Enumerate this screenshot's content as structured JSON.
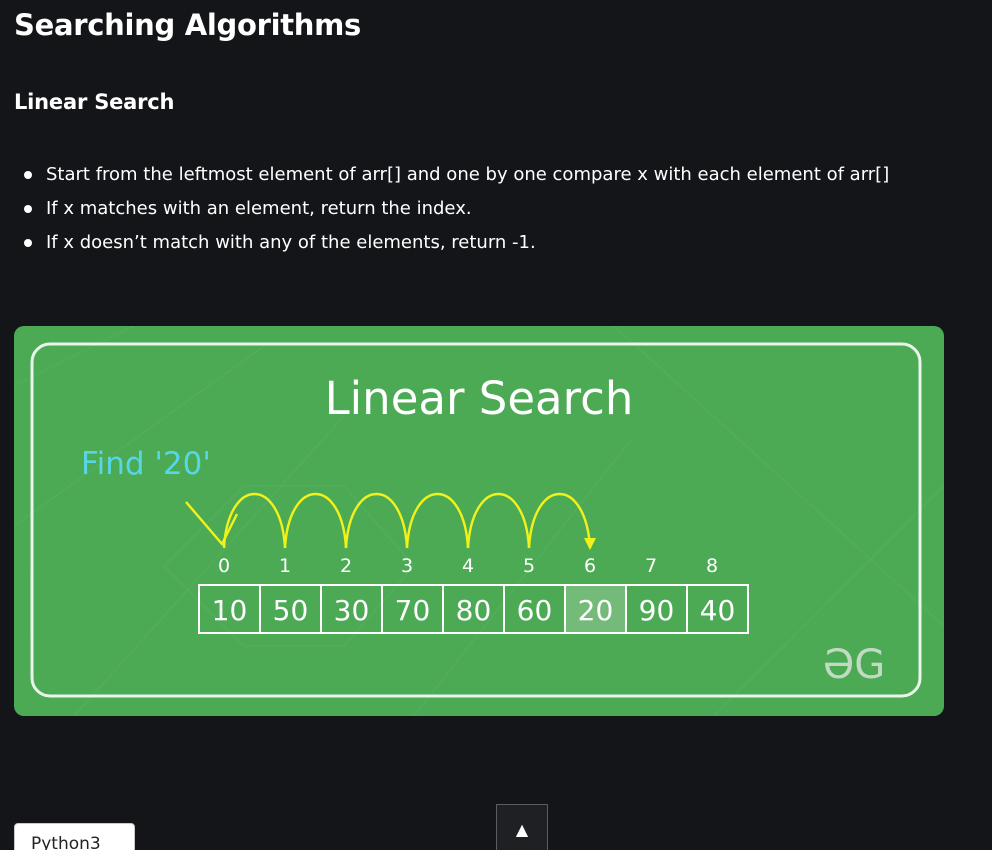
{
  "article": {
    "title": "Searching Algorithms",
    "section_title": "Linear Search",
    "bullets": [
      "Start from the leftmost element of arr[] and one by one compare x with each element of arr[]",
      "If x matches with an element, return the index.",
      "If x doesn’t match with any of the elements, return -1."
    ]
  },
  "figure": {
    "title": "Linear Search",
    "find_label": "Find '20'",
    "indices": [
      "0",
      "1",
      "2",
      "3",
      "4",
      "5",
      "6",
      "7",
      "8"
    ],
    "values": [
      "10",
      "50",
      "30",
      "70",
      "80",
      "60",
      "20",
      "90",
      "40"
    ],
    "found_index": 6,
    "logo_text": "ƏG",
    "colors": {
      "background": "#4caa55",
      "accent_text": "#58d6e6",
      "arrow": "#f2f21a",
      "found_cell": "#74bb7a"
    }
  },
  "buttons": {
    "language_button": "Python3",
    "scroll_top": "▲"
  }
}
